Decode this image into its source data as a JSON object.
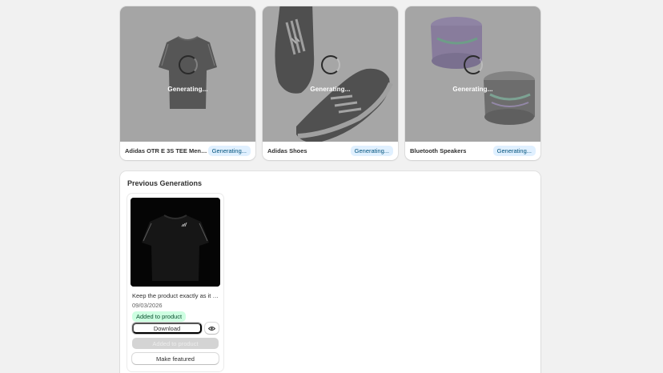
{
  "generating_cards": [
    {
      "name": "Adidas OTR E 3S TEE Men Ru...",
      "status": "Generating...",
      "overlay_text": "Generating..."
    },
    {
      "name": "Adidas Shoes",
      "status": "Generating...",
      "overlay_text": "Generating..."
    },
    {
      "name": "Bluetooth Speakers",
      "status": "Generating...",
      "overlay_text": "Generating..."
    }
  ],
  "previous": {
    "title": "Previous Generations",
    "items": [
      {
        "prompt": "Keep the product exactly as it a...",
        "date": "09/03/2026",
        "badge": "Added to product",
        "download_label": "Download",
        "disabled_label": "Added to product",
        "featured_label": "Make featured"
      }
    ]
  },
  "icons": {
    "preview": "eye-icon",
    "spinner": "spinner-icon"
  },
  "colors": {
    "badge_info_bg": "#e0f0ff",
    "badge_success_bg": "#cdfee1",
    "overlay": "#6e6e6e"
  }
}
